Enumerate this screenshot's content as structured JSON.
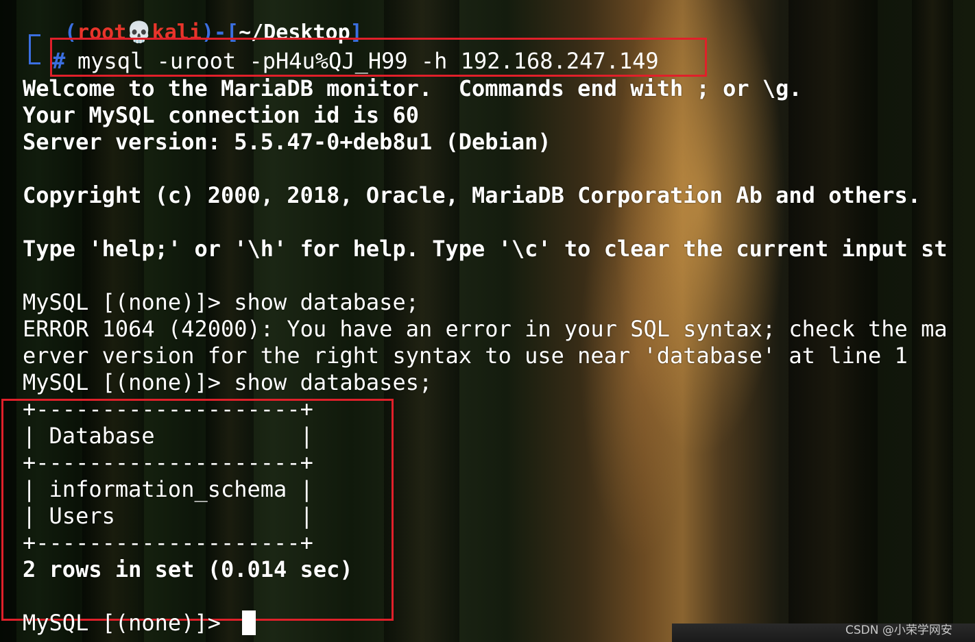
{
  "prompt": {
    "user": "root",
    "skull": "💀",
    "host": "kali",
    "path": "~/Desktop",
    "open_paren": "(",
    "close_paren": ")",
    "dash": "-",
    "open_bracket": "[",
    "close_bracket": "]",
    "hash": "#",
    "command": "mysql -uroot -pH4u%QJ_H99 -h 192.168.247.149"
  },
  "output": {
    "welcome": "Welcome to the MariaDB monitor.  Commands end with ; or \\g.",
    "connection": "Your MySQL connection id is 60",
    "server_version": "Server version: 5.5.47-0+deb8u1 (Debian)",
    "copyright": "Copyright (c) 2000, 2018, Oracle, MariaDB Corporation Ab and others.",
    "help": "Type 'help;' or '\\h' for help. Type '\\c' to clear the current input st",
    "cmd1": "MySQL [(none)]> show database;",
    "error_line1": "ERROR 1064 (42000): You have an error in your SQL syntax; check the ma",
    "error_line2": "erver version for the right syntax to use near 'database' at line 1",
    "cmd2": "MySQL [(none)]> show databases;",
    "table_border_top": "+--------------------+",
    "table_header": "| Database           |",
    "table_border_mid": "+--------------------+",
    "table_rows": [
      "| information_schema |",
      "| Users              |"
    ],
    "table_border_bottom": "+--------------------+",
    "rows_summary": "2 rows in set (0.014 sec)",
    "final_prompt": "MySQL [(none)]> "
  },
  "watermark": "CSDN @小荣学网安",
  "colors": {
    "prompt_blue": "#3b6fe0",
    "prompt_red": "#e8352b",
    "highlight_red": "#e0202a",
    "text": "#ffffff"
  }
}
